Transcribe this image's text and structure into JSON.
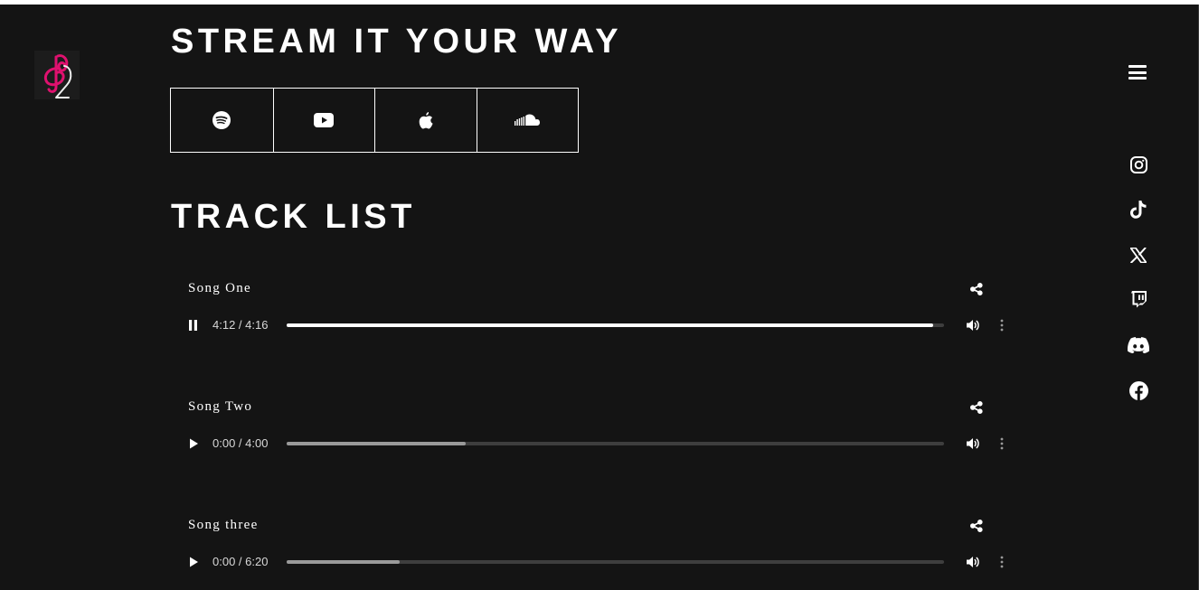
{
  "brand": {
    "logo_icon": "treble-clef-9-logo",
    "accent_color": "#e0116f"
  },
  "headings": {
    "stream": "STREAM IT YOUR WAY",
    "tracks": "TRACK LIST"
  },
  "stream_platforms": [
    {
      "name": "spotify",
      "icon": "spotify-icon"
    },
    {
      "name": "youtube",
      "icon": "youtube-icon"
    },
    {
      "name": "apple music",
      "icon": "apple-icon"
    },
    {
      "name": "soundcloud",
      "icon": "soundcloud-icon"
    }
  ],
  "nav": {
    "menu_icon": "hamburger-menu-icon"
  },
  "social_links": [
    {
      "name": "instagram",
      "icon": "instagram-icon"
    },
    {
      "name": "tiktok",
      "icon": "tiktok-icon"
    },
    {
      "name": "x",
      "icon": "x-icon"
    },
    {
      "name": "twitch",
      "icon": "twitch-icon"
    },
    {
      "name": "discord",
      "icon": "discord-icon"
    },
    {
      "name": "facebook",
      "icon": "facebook-icon"
    }
  ],
  "tracks": [
    {
      "title": "Song One",
      "time": "4:12 / 4:16",
      "state": "playing",
      "progress": 0.984
    },
    {
      "title": "Song Two",
      "time": "0:00 / 4:00",
      "state": "paused",
      "progress": 0.273
    },
    {
      "title": "Song three",
      "time": "0:00 / 6:20",
      "state": "paused",
      "progress": 0.172
    }
  ],
  "colors": {
    "background": "#141414",
    "text": "#ffffff",
    "seek_played": "#ffffff",
    "seek_buffered": "#9a9a9a",
    "seek_track": "#3e3e3e"
  }
}
